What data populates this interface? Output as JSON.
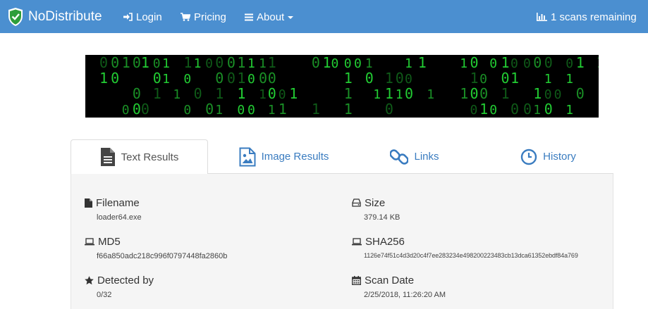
{
  "navbar": {
    "brand": "NoDistribute",
    "login": "Login",
    "pricing": "Pricing",
    "about": "About",
    "scans": "1 scans remaining",
    "icons": [
      "shield-check-icon",
      "sign-in-icon",
      "shopping-cart-icon",
      "bars-icon",
      "bar-chart-icon"
    ]
  },
  "tabs": [
    {
      "label": "Text Results",
      "icon": "file-text-icon",
      "active": true
    },
    {
      "label": "Image Results",
      "icon": "image-file-icon",
      "active": false
    },
    {
      "label": "Links",
      "icon": "link-icon",
      "active": false
    },
    {
      "label": "History",
      "icon": "clock-icon",
      "active": false
    }
  ],
  "results": {
    "filename": {
      "label": "Filename",
      "value": "loader64.exe"
    },
    "size": {
      "label": "Size",
      "value": "379.14 KB"
    },
    "md5": {
      "label": "MD5",
      "value": "f66a850adc218c996f0797448fa2860b"
    },
    "sha256": {
      "label": "SHA256",
      "value": "1126e74f51c4d3d20c4f7ee283234e498200223483cb13dca61352ebdf84a769"
    },
    "detected": {
      "label": "Detected by",
      "value": "0/32"
    },
    "scan_date": {
      "label": "Scan Date",
      "value": "2/25/2018, 11:26:20 AM"
    }
  },
  "colors": {
    "navbar": "#4b8fd0",
    "link": "#3a7cc0",
    "matrix_green": "#22cc33",
    "panel": "#f5f5f5"
  }
}
